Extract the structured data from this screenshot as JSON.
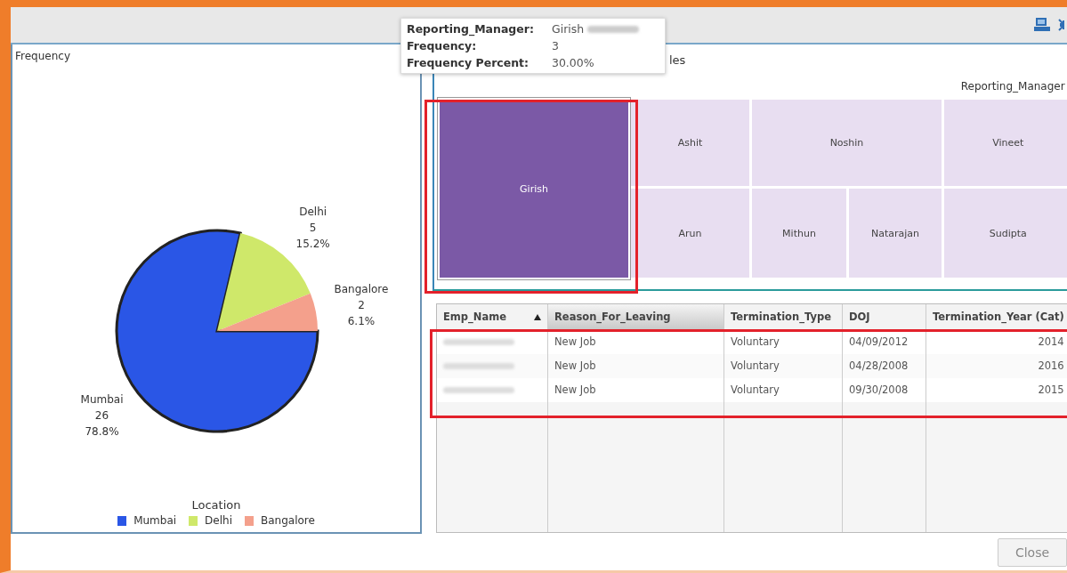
{
  "pie_panel": {
    "chart_data": {
      "type": "pie",
      "title": "Frequency",
      "categories": [
        "Mumbai",
        "Delhi",
        "Bangalore"
      ],
      "values": [
        78.8,
        15.2,
        6.1
      ],
      "value_labels": [
        "78.8%",
        "15.2%",
        "6.1%"
      ],
      "data_labels": true
    },
    "slices": [
      {
        "count": "26",
        "selected": true
      },
      {
        "count": "5",
        "selected": false
      },
      {
        "count": "2",
        "selected": false
      }
    ],
    "legend": {
      "title": "Location",
      "items": [
        {
          "label": "Mumbai",
          "color": "#2a56e6"
        },
        {
          "label": "Delhi",
          "color": "#cfe86a"
        },
        {
          "label": "Bangalore",
          "color": "#f4a08c"
        }
      ]
    }
  },
  "tooltip": {
    "rows": [
      {
        "label": "Reporting_Manager:",
        "value": "Girish"
      },
      {
        "label": "Frequency:",
        "value": "3"
      },
      {
        "label": "Frequency Percent:",
        "value": "30.00%"
      }
    ]
  },
  "treemap": {
    "title_fragment": "les",
    "axis_label": "Reporting_Manager",
    "tiles": [
      {
        "label": "Girish",
        "selected": true
      },
      {
        "label": "Ashit",
        "selected": false
      },
      {
        "label": "Arun",
        "selected": false
      },
      {
        "label": "Noshin",
        "selected": false
      },
      {
        "label": "Mithun",
        "selected": false
      },
      {
        "label": "Natarajan",
        "selected": false
      },
      {
        "label": "Vineet",
        "selected": false
      },
      {
        "label": "Sudipta",
        "selected": false
      }
    ]
  },
  "table": {
    "columns": [
      {
        "label": "Emp_Name",
        "sorted": true,
        "selected": false
      },
      {
        "label": "Reason_For_Leaving",
        "sorted": false,
        "selected": true
      },
      {
        "label": "Termination_Type",
        "sorted": false,
        "selected": false
      },
      {
        "label": "DOJ",
        "sorted": false,
        "selected": false
      },
      {
        "label": "Termination_Year (Cat)",
        "sorted": false,
        "selected": false
      }
    ],
    "rows": [
      [
        "",
        "New Job",
        "Voluntary",
        "04/09/2012",
        "2014"
      ],
      [
        "",
        "New Job",
        "Voluntary",
        "04/28/2008",
        "2016"
      ],
      [
        "",
        "New Job",
        "Voluntary",
        "09/30/2008",
        "2015"
      ]
    ]
  },
  "close_button": {
    "label": "Close"
  }
}
